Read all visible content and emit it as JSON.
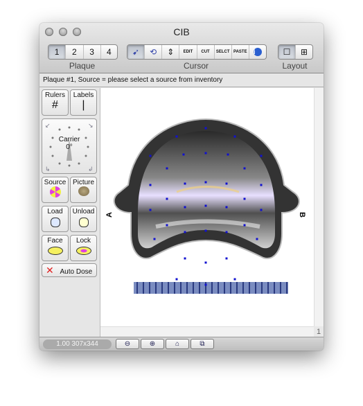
{
  "window": {
    "title": "CIB"
  },
  "toolbar": {
    "plaque": {
      "label": "Plaque",
      "items": [
        "1",
        "2",
        "3",
        "4"
      ],
      "selected": "1"
    },
    "cursor": {
      "label": "Cursor",
      "items": [
        "pointer-source",
        "rotate",
        "move",
        "EDIT",
        "CUT",
        "SELCT",
        "PASTE",
        "info"
      ],
      "selected": "pointer-source"
    },
    "layout": {
      "label": "Layout",
      "items": [
        "single",
        "grid"
      ],
      "selected": "single"
    }
  },
  "status": "Plaque #1, Source = please select a source from inventory",
  "sidebar": {
    "rulers": "Rulers",
    "labels": "Labels",
    "carrier": {
      "label": "Carrier",
      "angle": "0°"
    },
    "source": "Source",
    "picture": "Picture",
    "load": "Load",
    "unload": "Unload",
    "face": "Face",
    "lock": "Lock",
    "auto_dose": "Auto Dose"
  },
  "canvas": {
    "label_a": "A",
    "label_b": "B",
    "page": "1"
  },
  "bottom": {
    "zoom": "1.00 307x344"
  },
  "colors": {
    "dots": "#1010d0",
    "ruler": "#5a6fa8"
  }
}
